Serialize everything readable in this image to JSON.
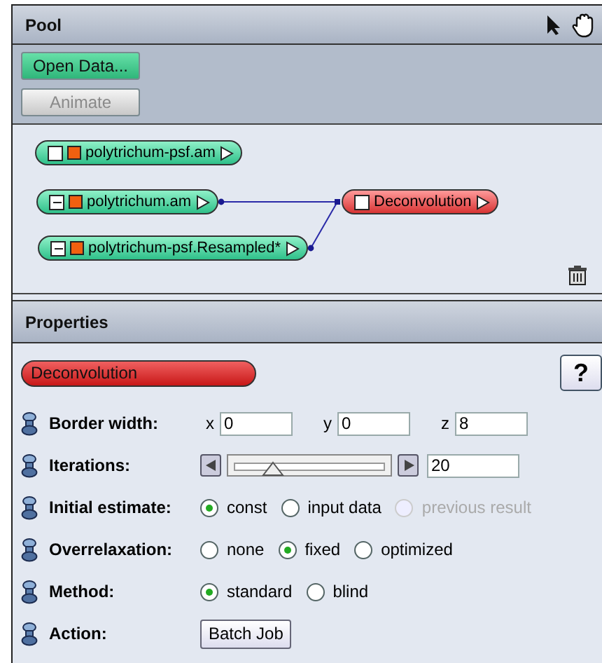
{
  "pool": {
    "title": "Pool",
    "buttons": [
      {
        "label": "Open Data...",
        "disabled": false
      },
      {
        "label": "Animate",
        "disabled": true
      }
    ],
    "nodes": [
      {
        "label": "polytrichum-psf.am",
        "kind": "data",
        "expanded": false,
        "connected": false
      },
      {
        "label": "polytrichum.am",
        "kind": "data",
        "expanded": true,
        "connected": true
      },
      {
        "label": "polytrichum-psf.Resampled*",
        "kind": "data",
        "expanded": true,
        "connected": true
      },
      {
        "label": "Deconvolution",
        "kind": "compute",
        "expanded": false,
        "connected": false
      }
    ]
  },
  "properties": {
    "title": "Properties",
    "module": "Deconvolution",
    "help": "?",
    "rows": [
      {
        "kind": "xyz",
        "label": "Border width:",
        "fields": [
          {
            "axis": "x",
            "value": "0"
          },
          {
            "axis": "y",
            "value": "0"
          },
          {
            "axis": "z",
            "value": "8"
          }
        ]
      },
      {
        "kind": "slider",
        "label": "Iterations:",
        "level": 0.24,
        "value": "20"
      },
      {
        "kind": "radio",
        "label": "Initial estimate:",
        "options": [
          {
            "label": "const",
            "selected": true,
            "disabled": false
          },
          {
            "label": "input data",
            "selected": false,
            "disabled": false
          },
          {
            "label": "previous result",
            "selected": false,
            "disabled": true
          }
        ]
      },
      {
        "kind": "radio",
        "label": "Overrelaxation:",
        "options": [
          {
            "label": "none",
            "selected": false,
            "disabled": false
          },
          {
            "label": "fixed",
            "selected": true,
            "disabled": false
          },
          {
            "label": "optimized",
            "selected": false,
            "disabled": false
          }
        ]
      },
      {
        "kind": "radio",
        "label": "Method:",
        "options": [
          {
            "label": "standard",
            "selected": true,
            "disabled": false
          },
          {
            "label": "blind",
            "selected": false,
            "disabled": false
          }
        ]
      },
      {
        "kind": "button",
        "label": "Action:",
        "button": "Batch Job"
      }
    ]
  }
}
